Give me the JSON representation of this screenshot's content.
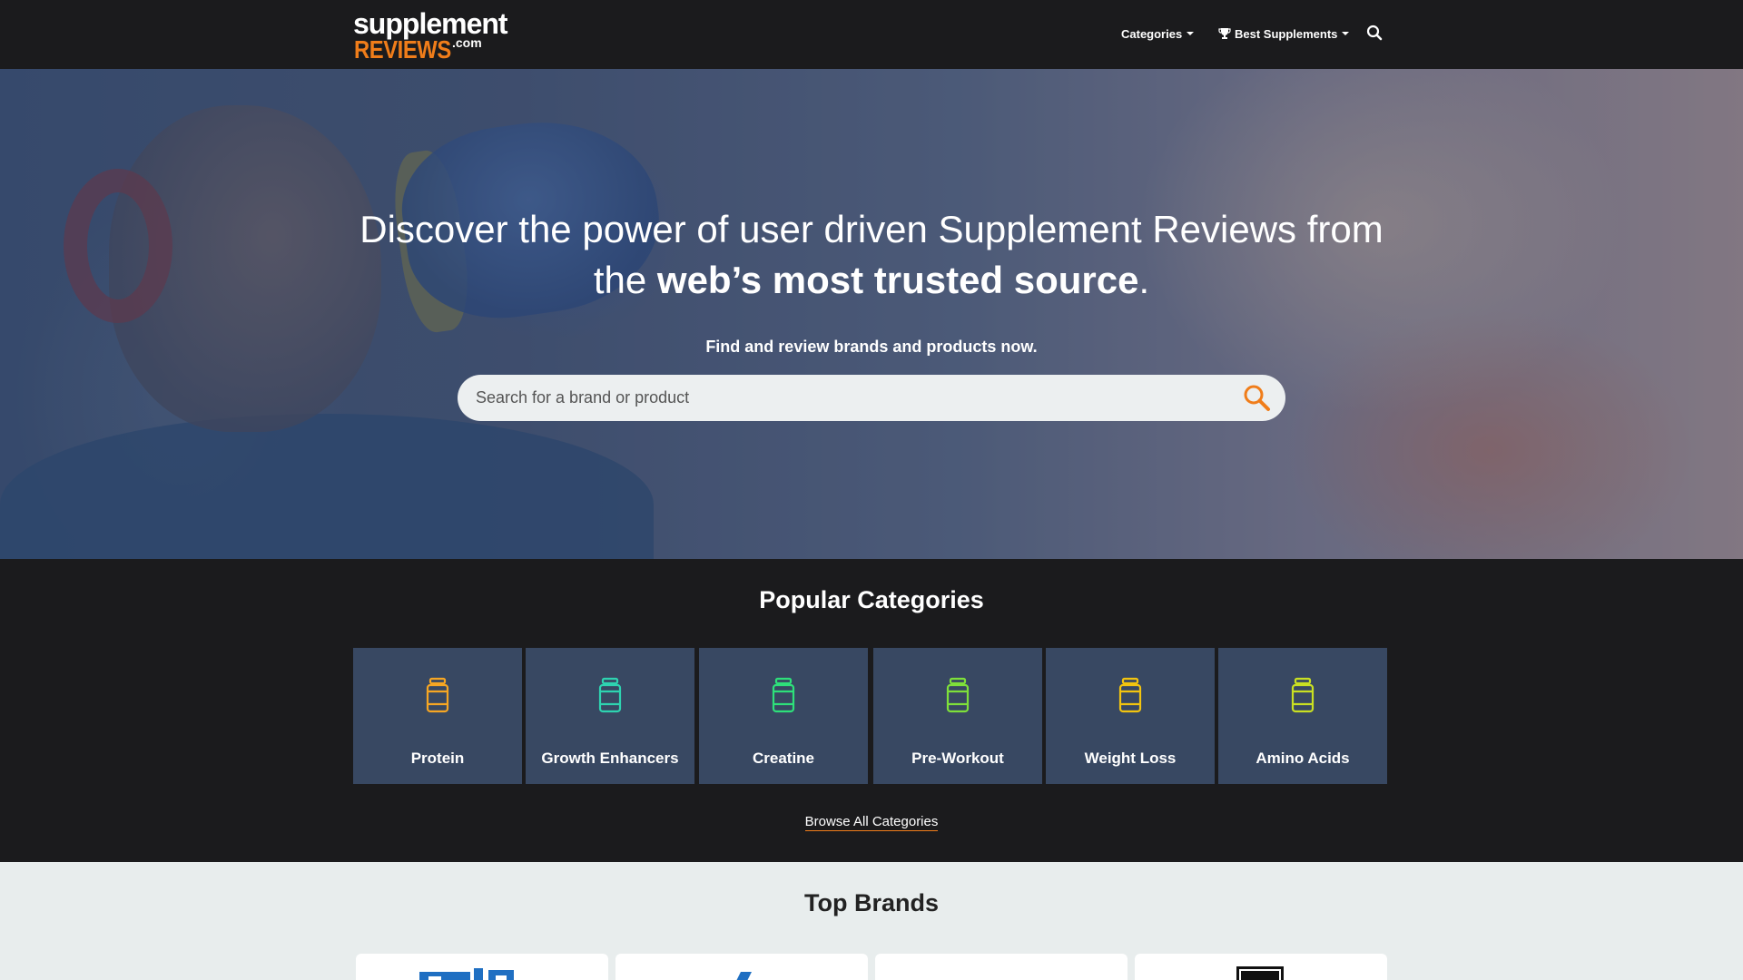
{
  "logo": {
    "line1": "supplement",
    "line2": "REVIEWS",
    "suffix": ".com"
  },
  "nav": {
    "categories_label": "Categories",
    "best_label": "Best Supplements",
    "icons": {
      "categories_caret": "caret-down-icon",
      "trophy": "trophy-icon",
      "search": "search-icon"
    }
  },
  "hero": {
    "title_part1": "Discover the power of user driven Supplement Reviews from the ",
    "title_bold": "web’s most trusted source",
    "title_end": ".",
    "subtitle": "Find and review brands and products now.",
    "search_placeholder": "Search for a brand or product",
    "search_icon": "magnifier-icon"
  },
  "popular": {
    "title": "Popular Categories",
    "categories": [
      {
        "label": "Protein",
        "icon_color": "#f6a623"
      },
      {
        "label": "Growth Enhancers",
        "icon_color": "#2ed3b0"
      },
      {
        "label": "Creatine",
        "icon_color": "#2ee07a"
      },
      {
        "label": "Pre-Workout",
        "icon_color": "#7ee03a"
      },
      {
        "label": "Weight Loss",
        "icon_color": "#f2c40f"
      },
      {
        "label": "Amino Acids",
        "icon_color": "#c9e022"
      }
    ],
    "browse_all": "Browse All Categories"
  },
  "brands": {
    "title": "Top Brands",
    "items": [
      {
        "logo": "brand-logo-blue"
      },
      {
        "logo": "brand-logo-slash"
      },
      {
        "logo": "brand-logo-grey"
      },
      {
        "logo": "brand-logo-black"
      }
    ]
  },
  "colors": {
    "accent": "#f07d1a",
    "nav_bg": "#1b1b1d",
    "tile_bg": "#384862",
    "page_bg": "#e8eded"
  }
}
